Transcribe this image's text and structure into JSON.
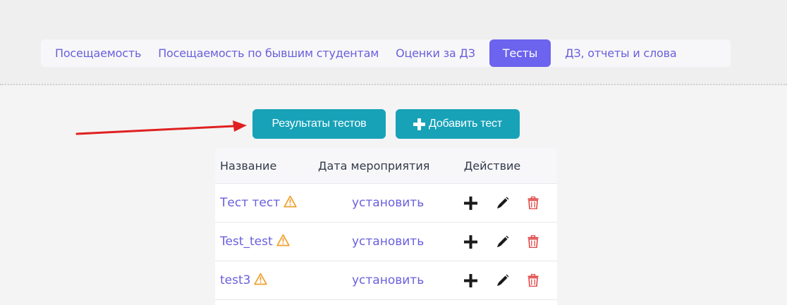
{
  "tabs": [
    {
      "label": "Посещаемость",
      "active": false
    },
    {
      "label": "Посещаемость по бывшим студентам",
      "active": false
    },
    {
      "label": "Оценки за ДЗ",
      "active": false
    },
    {
      "label": "Тесты",
      "active": true
    },
    {
      "label": "ДЗ, отчеты и слова",
      "active": false
    }
  ],
  "toolbar": {
    "results_label": "Результаты тестов",
    "add_label": "Добавить тест"
  },
  "table": {
    "headers": {
      "name": "Название",
      "date": "Дата мероприятия",
      "action": "Действие"
    },
    "rows": [
      {
        "name": "Тест тест",
        "date": "установить"
      },
      {
        "name": "Test_test",
        "date": "установить"
      },
      {
        "name": "test3",
        "date": "установить"
      }
    ]
  },
  "icons": {
    "warning": "warning-icon",
    "add": "plus-icon",
    "edit": "pencil-icon",
    "delete": "trash-icon"
  },
  "colors": {
    "accent": "#6c63ee",
    "link": "#6a5fdc",
    "button": "#17a2b8",
    "warning": "#f0a030",
    "delete": "#e04848",
    "annotation_arrow": "#e02020"
  }
}
